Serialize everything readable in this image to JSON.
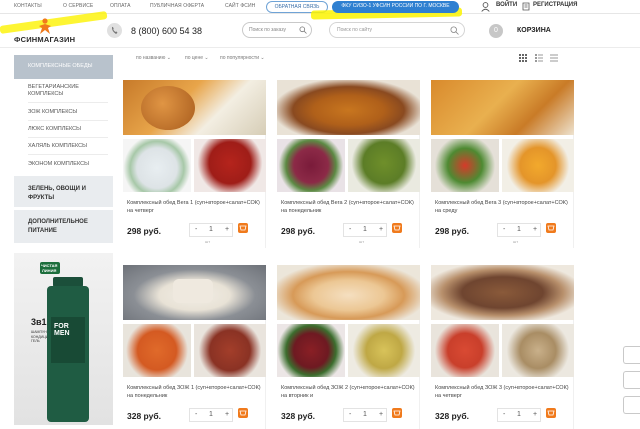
{
  "topbar": {
    "nav": [
      "КОНТАКТЫ",
      "О СЕРВИСЕ",
      "ОПЛАТА",
      "ПУБЛИЧНАЯ ОФЕРТА",
      "САЙТ ФСИН"
    ],
    "feedback_label": "ОБРАТНАЯ СВЯЗЬ",
    "region_label": "ФКУ СИЗО-1 УФСИН РОССИИ ПО Г. МОСКВЕ",
    "login_label": "ВОЙТИ",
    "register_label": "РЕГИСТРАЦИЯ",
    "highlight_color": "#fcf300"
  },
  "header": {
    "logo_text": "ФСИНМАГАЗИН",
    "phone": "8 (800) 600 54 38",
    "order_search_placeholder": "Поиск по заказу",
    "site_search_placeholder": "Поиск по сайту",
    "cart_count": "0",
    "cart_label": "КОРЗИНА",
    "brand_color": "#f07a1c"
  },
  "sidebar": {
    "active": "КОМПЛЕКСНЫЕ ОБЕДЫ",
    "items": [
      "ВЕГЕТАРИАНСКИЕ КОМПЛЕКСЫ",
      "ЗОЖ КОМПЛЕКСЫ",
      "ЛЮКС КОМПЛЕКСЫ",
      "ХАЛЯЛЬ КОМПЛЕКСЫ",
      "ЭКОНОМ КОМПЛЕКСЫ"
    ],
    "groups": [
      "ЗЕЛЕНЬ, ОВОЩИ И ФРУКТЫ",
      "ДОПОЛНИТЕЛЬНОЕ ПИТАНИЕ"
    ]
  },
  "ad": {
    "brand_top": "ЧИСТАЯ",
    "brand_bottom": "ЛИНИЯ",
    "for_men": "FOR MEN",
    "offer": "3в1",
    "desc": "ШАМПУНЬ + КОНДИЦИОНЕР ГЕЛЬ"
  },
  "sort": {
    "by_name": "по названию",
    "by_price": "по цене",
    "by_popularity": "по популярности"
  },
  "products": [
    {
      "title": "Комплексный обед Вега 1 (суп+второе+салат+СОК) на четверг",
      "price": "298 руб.",
      "qty": "1",
      "unit": "шт"
    },
    {
      "title": "Комплексный обед Вега 2 (суп+второе+салат+СОК) на понедельник",
      "price": "298 руб.",
      "qty": "1",
      "unit": "шт"
    },
    {
      "title": "Комплексный обед Вега 3 (суп+второе+салат+СОК) на среду",
      "price": "298 руб.",
      "qty": "1",
      "unit": "шт"
    },
    {
      "title": "Комплексный обед ЗОЖ 1 (суп+второе+салат+СОК) на понедельник",
      "price": "328 руб.",
      "qty": "1",
      "unit": "шт"
    },
    {
      "title": "Комплексный обед ЗОЖ 2 (суп+второе+салат+СОК) на вторник и",
      "price": "328 руб.",
      "qty": "1",
      "unit": "шт"
    },
    {
      "title": "Комплексный обед ЗОЖ 3 (суп+второе+салат+СОК) на четверг",
      "price": "328 руб.",
      "qty": "1",
      "unit": "шт"
    }
  ],
  "controls": {
    "minus": "-",
    "plus": "+"
  }
}
